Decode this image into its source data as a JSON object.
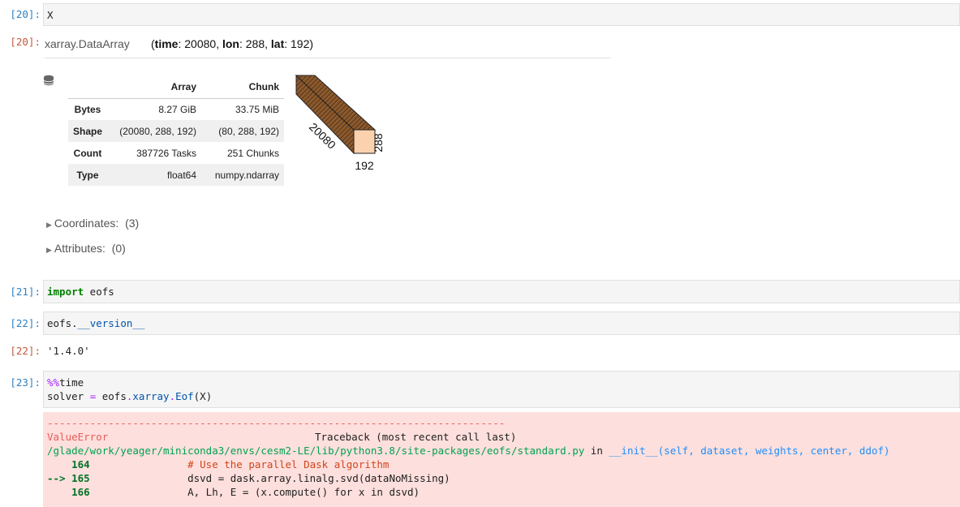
{
  "cells": {
    "c20_in": {
      "prompt": "[20]:",
      "code": "X"
    },
    "c20_out": {
      "prompt": "[20]:",
      "type": "xarray.DataArray",
      "dims": [
        {
          "name": "time",
          "size": "20080"
        },
        {
          "name": "lon",
          "size": "288"
        },
        {
          "name": "lat",
          "size": "192"
        }
      ],
      "table": {
        "headers": [
          "",
          "Array",
          "Chunk"
        ],
        "rows": [
          {
            "label": "Bytes",
            "array": "8.27 GiB",
            "chunk": "33.75 MiB"
          },
          {
            "label": "Shape",
            "array": "(20080, 288, 192)",
            "chunk": "(80, 288, 192)"
          },
          {
            "label": "Count",
            "array": "387726 Tasks",
            "chunk": "251 Chunks"
          },
          {
            "label": "Type",
            "array": "float64",
            "chunk": "numpy.ndarray"
          }
        ]
      },
      "cube_labels": {
        "depth": "20080",
        "height": "288",
        "width": "192"
      },
      "coordinates_label": "Coordinates:",
      "coordinates_count": "(3)",
      "attributes_label": "Attributes:",
      "attributes_count": "(0)"
    },
    "c21_in": {
      "prompt": "[21]:",
      "keyword": "import",
      "rest": " eofs"
    },
    "c22_in": {
      "prompt": "[22]:",
      "obj": "eofs.",
      "dunder": "__version__"
    },
    "c22_out": {
      "prompt": "[22]:",
      "value": "'1.4.0'"
    },
    "c23_in": {
      "prompt": "[23]:",
      "magic": "%%",
      "magic_word": "time",
      "line2_a": "solver ",
      "line2_eq": "=",
      "line2_b": " eofs",
      "line2_dot1": ".",
      "line2_c": "xarray",
      "line2_dot2": ".",
      "line2_d": "Eof",
      "line2_e": "(X)"
    },
    "error": {
      "dashes": "---------------------------------------------------------------------------",
      "name": "ValueError",
      "traceback": "Traceback (most recent call last)",
      "path": "/glade/work/yeager/miniconda3/envs/cesm2-LE/lib/python3.8/site-packages/eofs/standard.py",
      "in_word": " in ",
      "func": "__init__(self, dataset, weights, center, ddof)",
      "lines": [
        {
          "arrow": "    ",
          "num": "164",
          "code": "                # Use the parallel Dask algorithm"
        },
        {
          "arrow": "--> ",
          "num": "165",
          "code": "                dsvd = dask.array.linalg.svd(dataNoMissing)"
        },
        {
          "arrow": "    ",
          "num": "166",
          "code": "                A, Lh, E = (x.compute() for x in dsvd)"
        }
      ]
    }
  },
  "colors": {
    "in_prompt": "#307fc1",
    "out_prompt": "#bf5b3d",
    "cube_face": "#fbd2ad",
    "cube_side": "#8c5a2e",
    "error_bg": "#fddfdd"
  },
  "icons": {
    "db": "database-icon",
    "triangle": "triangle-right-icon"
  }
}
